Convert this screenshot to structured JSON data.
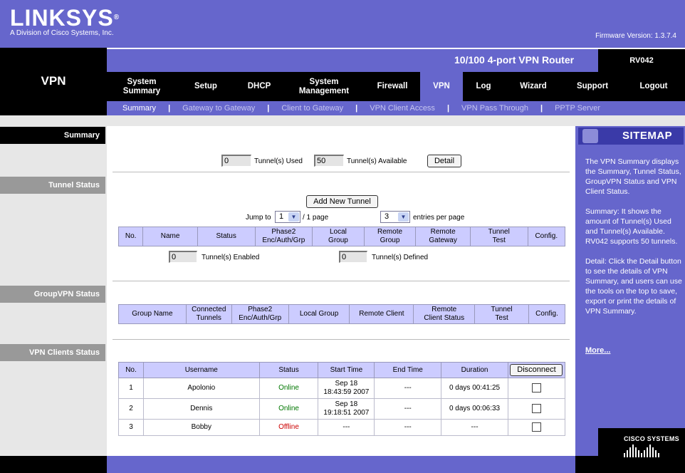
{
  "header": {
    "logo": "LINKSYS",
    "logo_sub": "A Division of Cisco Systems, Inc.",
    "firmware": "Firmware Version: 1.3.7.4",
    "product_name": "10/100 4-port VPN Router",
    "model": "RV042",
    "section_title": "VPN"
  },
  "tabs": [
    {
      "label": "System\nSummary"
    },
    {
      "label": "Setup"
    },
    {
      "label": "DHCP"
    },
    {
      "label": "System\nManagement"
    },
    {
      "label": "Firewall"
    },
    {
      "label": "VPN"
    },
    {
      "label": "Log"
    },
    {
      "label": "Wizard"
    },
    {
      "label": "Support"
    },
    {
      "label": "Logout"
    }
  ],
  "subtabs": [
    {
      "label": "Summary"
    },
    {
      "label": "Gateway to Gateway"
    },
    {
      "label": "Client to Gateway"
    },
    {
      "label": "VPN Client Access"
    },
    {
      "label": "VPN Pass Through"
    },
    {
      "label": "PPTP Server"
    }
  ],
  "sections": {
    "summary": "Summary",
    "tunnel_status": "Tunnel Status",
    "groupvpn_status": "GroupVPN Status",
    "vpn_clients_status": "VPN Clients Status"
  },
  "summary": {
    "tunnels_used_value": "0",
    "tunnels_used_label": "Tunnel(s) Used",
    "tunnels_available_value": "50",
    "tunnels_available_label": "Tunnel(s) Available",
    "detail_button": "Detail"
  },
  "tunnel_status": {
    "add_button": "Add New Tunnel",
    "jump_to_label": "Jump to",
    "jump_to_value": "1",
    "page_suffix": "/ 1 page",
    "entries_value": "3",
    "entries_label": "entries per page",
    "columns": [
      "No.",
      "Name",
      "Status",
      "Phase2\nEnc/Auth/Grp",
      "Local\nGroup",
      "Remote\nGroup",
      "Remote\nGateway",
      "Tunnel\nTest",
      "Config."
    ],
    "enabled_value": "0",
    "enabled_label": "Tunnel(s) Enabled",
    "defined_value": "0",
    "defined_label": "Tunnel(s) Defined"
  },
  "groupvpn": {
    "columns": [
      "Group Name",
      "Connected\nTunnels",
      "Phase2\nEnc/Auth/Grp",
      "Local Group",
      "Remote Client",
      "Remote\nClient Status",
      "Tunnel\nTest",
      "Config."
    ]
  },
  "vpn_clients": {
    "columns": [
      "No.",
      "Username",
      "Status",
      "Start Time",
      "End Time",
      "Duration"
    ],
    "disconnect_button": "Disconnect",
    "rows": [
      {
        "no": "1",
        "username": "Apolonio",
        "status": "Online",
        "start": "Sep 18\n18:43:59 2007",
        "end": "---",
        "duration": "0 days 00:41:25",
        "checked": false
      },
      {
        "no": "2",
        "username": "Dennis",
        "status": "Online",
        "start": "Sep 18\n19:18:51 2007",
        "end": "---",
        "duration": "0 days 00:06:33",
        "checked": false
      },
      {
        "no": "3",
        "username": "Bobby",
        "status": "Offline",
        "start": "---",
        "end": "---",
        "duration": "---",
        "checked": false
      }
    ]
  },
  "sitemap": {
    "title": "SITEMAP",
    "paragraphs": [
      "The VPN Summary displays the Summary, Tunnel Status, GroupVPN Status and VPN Client Status.",
      "Summary: It shows the amount of Tunnel(s) Used and Tunnel(s) Available. RV042 supports 50 tunnels.",
      "Detail: Click the Detail button to see the details of VPN Summary, and users can use the tools on the top to save, export or print the details of VPN Summary."
    ],
    "more_link": "More...",
    "cisco_logo": "CISCO SYSTEMS"
  },
  "colors": {
    "brand_purple": "#6666cc",
    "table_header": "#ccccff",
    "online": "#007700",
    "offline": "#cc0000"
  }
}
